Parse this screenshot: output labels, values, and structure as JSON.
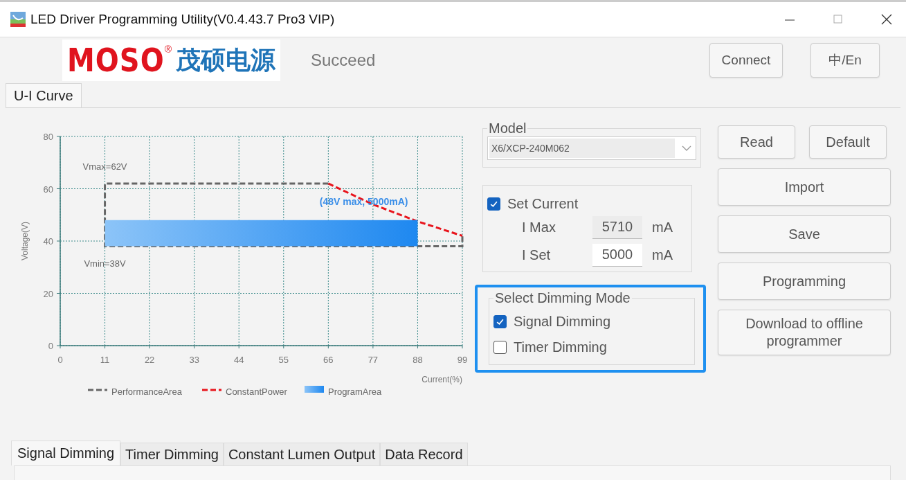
{
  "window": {
    "title": "LED Driver Programming Utility(V0.4.43.7 Pro3 VIP)"
  },
  "header": {
    "logo": {
      "brand": "MOSO",
      "mark": "®",
      "name": "茂硕电源"
    },
    "status": "Succeed",
    "buttons": [
      "Connect",
      "中/En"
    ]
  },
  "top_tabs": [
    {
      "label": "U-I Curve",
      "selected": true
    }
  ],
  "chart": {
    "chart_data": {
      "type": "line",
      "xlabel": "Current(%)",
      "ylabel": "Voltage(V)",
      "grid": true,
      "legend": true,
      "xlim": [
        0,
        99
      ],
      "ylim": [
        0,
        80
      ],
      "xticks": [
        0,
        11,
        22,
        33,
        44,
        55,
        66,
        77,
        88,
        99
      ],
      "yticks": [
        0,
        20,
        40,
        60,
        80
      ],
      "series": [
        {
          "name": "PerformanceArea",
          "color": "#666666",
          "line_style": "dashed",
          "x": [
            66,
            11,
            11,
            99,
            99
          ],
          "values": [
            62,
            62,
            38,
            38,
            42
          ]
        },
        {
          "name": "ConstantPower",
          "color": "#e8141c",
          "line_style": "dashed",
          "x": [
            66,
            77,
            88,
            99
          ],
          "values": [
            62,
            54,
            47.5,
            42
          ]
        },
        {
          "name": "ProgramArea",
          "type": "area",
          "color": "#1e88f0",
          "x": [
            11,
            11,
            88,
            88
          ],
          "values": [
            38,
            48,
            48,
            38
          ]
        }
      ],
      "annotations": [
        {
          "text": "Vmax=62V",
          "y": 62
        },
        {
          "text": "Vmin=38V",
          "y": 38
        },
        {
          "text": "(48V max, 5000mA)",
          "y": 48
        }
      ]
    }
  },
  "model": {
    "label": "Model",
    "value": "X6/XCP-240M062"
  },
  "set_current": {
    "label": "Set Current",
    "checked": true,
    "rows": [
      {
        "label": "I Max",
        "value": "5710",
        "unit": "mA",
        "disabled": true
      },
      {
        "label": "I Set",
        "value": "5000",
        "unit": "mA",
        "disabled": false
      }
    ]
  },
  "dimming_mode": {
    "label": "Select Dimming Mode",
    "highlighted": true,
    "options": [
      {
        "label": "Signal Dimming",
        "checked": true
      },
      {
        "label": "Timer Dimming",
        "checked": false
      }
    ]
  },
  "buttons": [
    {
      "label": "Read",
      "kind": "half"
    },
    {
      "label": "Default",
      "kind": "half"
    },
    {
      "label": "Import",
      "kind": "full"
    },
    {
      "label": "Save",
      "kind": "full"
    },
    {
      "label": "Programming",
      "kind": "full"
    },
    {
      "label": "Download to offline programmer",
      "kind": "full"
    }
  ],
  "bottom_tabs": [
    {
      "label": "Signal Dimming",
      "selected": true
    },
    {
      "label": "Timer Dimming",
      "selected": false
    },
    {
      "label": "Constant Lumen Output",
      "selected": false
    },
    {
      "label": "Data Record",
      "selected": false
    }
  ]
}
